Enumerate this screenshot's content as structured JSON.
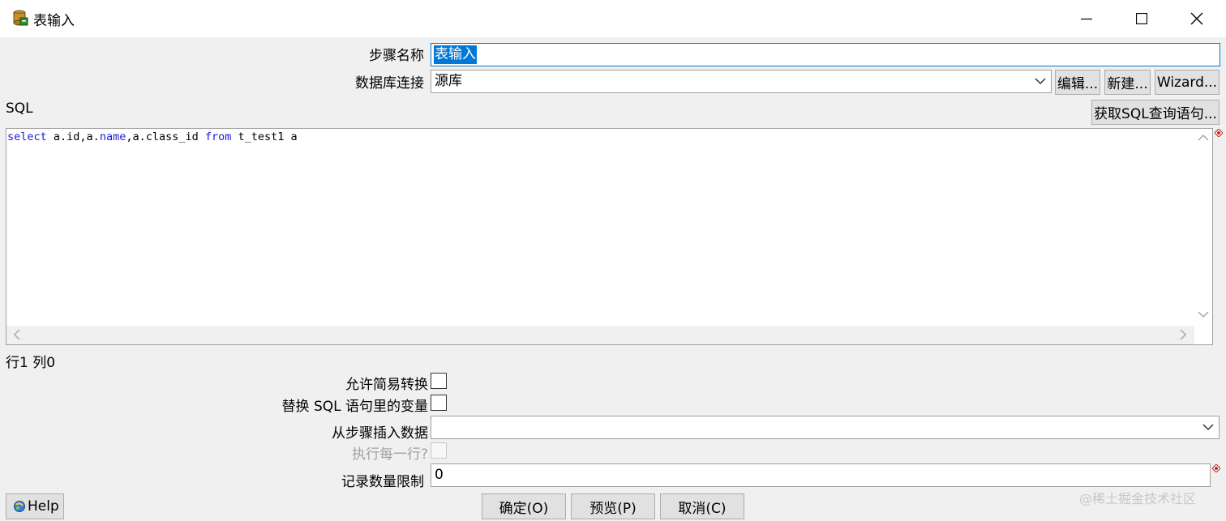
{
  "window": {
    "title": "表输入"
  },
  "form": {
    "step_name_label": "步骤名称",
    "step_name_value": "表输入",
    "db_conn_label": "数据库连接",
    "db_conn_value": "源库",
    "edit_button": "编辑...",
    "new_button": "新建...",
    "wizard_button": "Wizard...",
    "sql_label": "SQL",
    "get_sql_button": "获取SQL查询语句...",
    "sql_tokens": [
      {
        "text": "select",
        "kw": true
      },
      {
        "text": " a.id,a.",
        "kw": false
      },
      {
        "text": "name",
        "kw": true
      },
      {
        "text": ",a.class_id ",
        "kw": false
      },
      {
        "text": "from",
        "kw": true
      },
      {
        "text": " t_test1 a",
        "kw": false
      }
    ],
    "cursor_position": "行1 列0",
    "lazy_conversion_label": "允许简易转换",
    "replace_vars_label": "替换 SQL 语句里的变量",
    "insert_from_step_label": "从步骤插入数据",
    "insert_from_step_value": "",
    "execute_each_row_label": "执行每一行?",
    "limit_label": "记录数量限制",
    "limit_value": "0"
  },
  "footer": {
    "help_button": "Help",
    "ok_button": "确定(O)",
    "preview_button": "预览(P)",
    "cancel_button": "取消(C)",
    "watermark": "@稀土掘金技术社区"
  },
  "colors": {
    "sql_keyword": "#1c1cd6",
    "selection": "#0078d7",
    "focus_border": "#0078d7"
  }
}
